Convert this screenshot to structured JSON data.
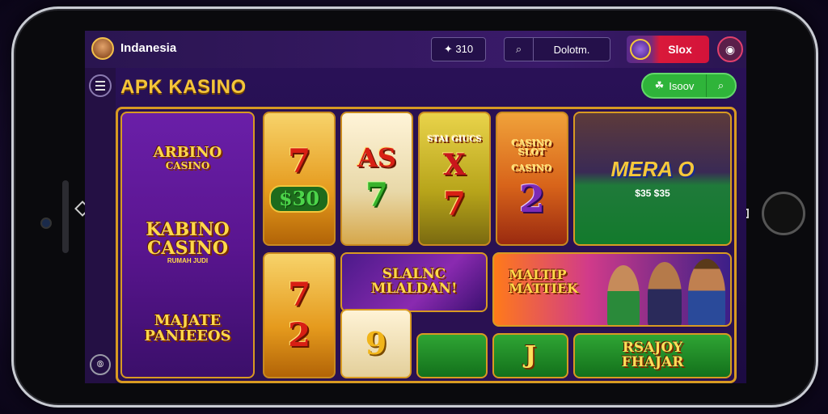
{
  "topbar": {
    "brand": "Indanesia",
    "bet_label": "✦ 310",
    "deposit_label": "Dolotm.",
    "slot_button": "Slox"
  },
  "header": {
    "title": "APK KASINO",
    "search_label": "Isoov"
  },
  "tiles": {
    "left": {
      "line1": "ARBINO",
      "line1b": "CASINO",
      "line2": "KABINO",
      "line2b": "CASINO",
      "line2_small": "RUMAH JUDI",
      "line3": "MAJATE",
      "line3b": "PANIEEOS"
    },
    "reel1": {
      "top": "7",
      "bottom": "$30"
    },
    "reel2": {
      "top": "AS",
      "bottom": "7"
    },
    "reel3": {
      "label": "STAI GIUCS",
      "top": "X",
      "bottom": "7"
    },
    "reel4": {
      "label": "CASINO SLOT",
      "label2": "CASINO",
      "bottom": "2"
    },
    "table": {
      "title": "MERA",
      "title2": "O",
      "chips": "$35  $35"
    },
    "reel5": {
      "top": "7",
      "bottom": "2"
    },
    "slot_promo": {
      "line1": "SLALNC",
      "line2": "MLALDAN!"
    },
    "bottom_nine": "9",
    "sports": {
      "line1": "MALTIP",
      "line2": "MATTIEK"
    },
    "green_small": "J",
    "enjoy": {
      "line1": "RSAJOY",
      "line2": "FHAJAR"
    }
  },
  "colors": {
    "accent_gold": "#f4c53a",
    "slot_red": "#d4133a",
    "search_green": "#2fb43a",
    "screen_purple": "#2b1259"
  }
}
